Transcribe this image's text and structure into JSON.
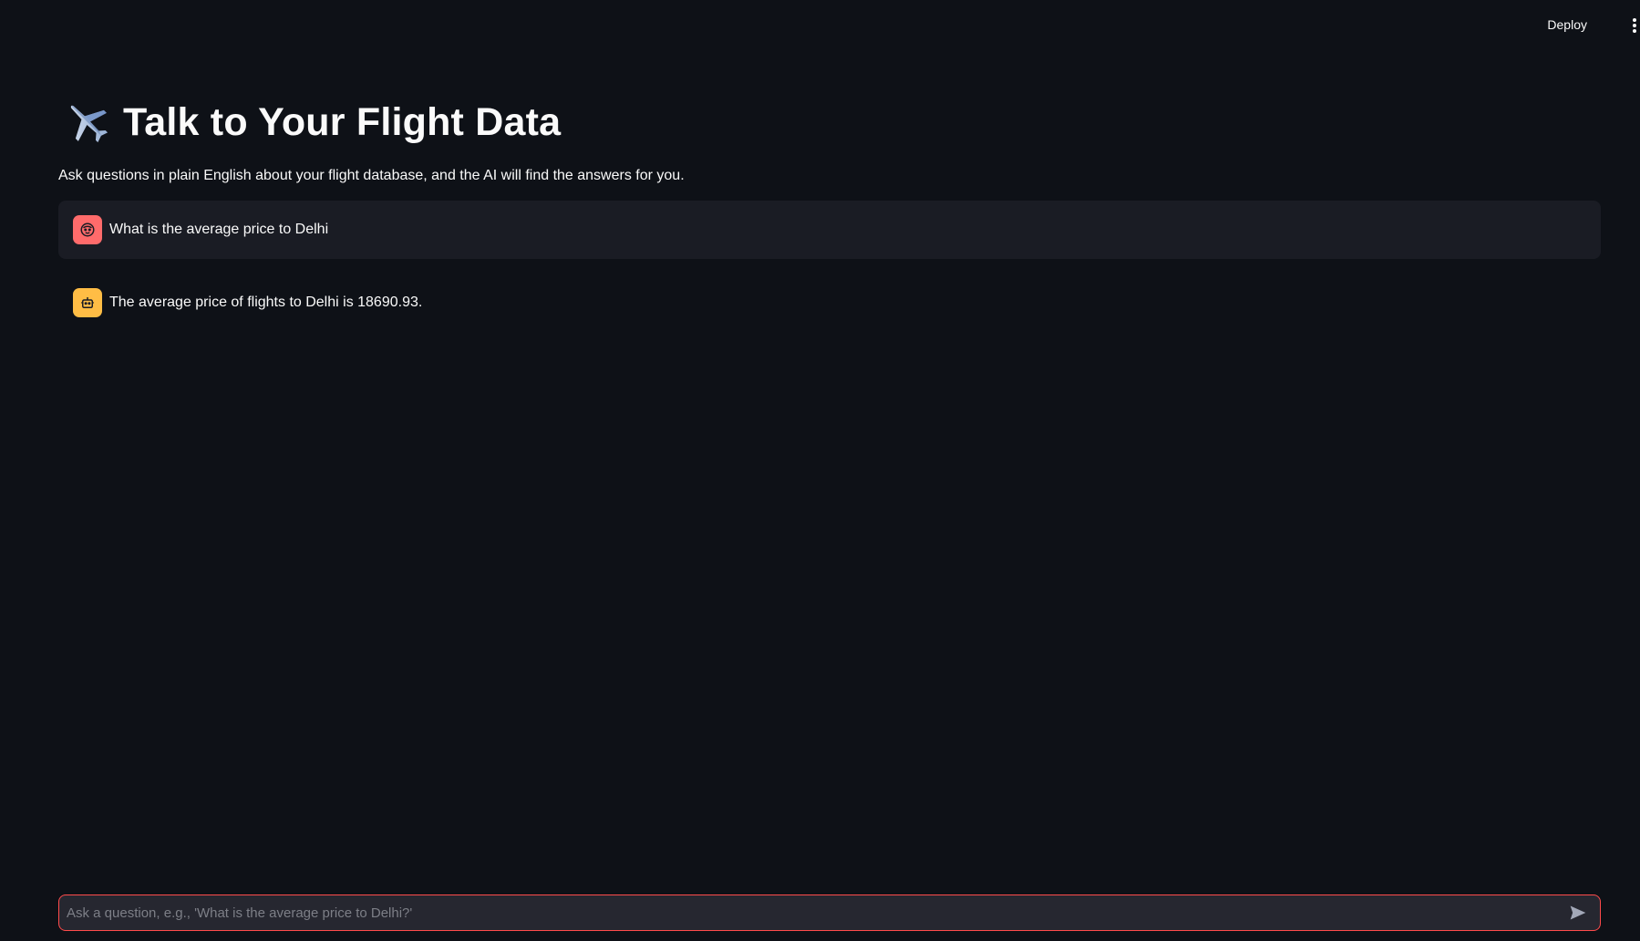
{
  "header": {
    "deploy_label": "Deploy",
    "menu_icon": "kebab-menu-icon"
  },
  "main": {
    "title_icon": "airplane-icon",
    "title": "Talk to Your Flight Data",
    "subtitle": "Ask questions in plain English about your flight database, and the AI will find the answers for you."
  },
  "chat": {
    "messages": [
      {
        "role": "user",
        "avatar_icon": "user-face-icon",
        "avatar_color": "#ff6b6b",
        "text": "What is the average price to Delhi"
      },
      {
        "role": "assistant",
        "avatar_icon": "robot-icon",
        "avatar_color": "#ffbd45",
        "text": "The average price of flights to Delhi is 18690.93."
      }
    ]
  },
  "chat_input": {
    "placeholder": "Ask a question, e.g., 'What is the average price to Delhi?'",
    "value": "",
    "send_icon": "send-icon"
  },
  "colors": {
    "background": "#0e1117",
    "user_bubble": "#1a1c24",
    "input_border": "#ff4b4b",
    "input_bg": "#262730"
  }
}
